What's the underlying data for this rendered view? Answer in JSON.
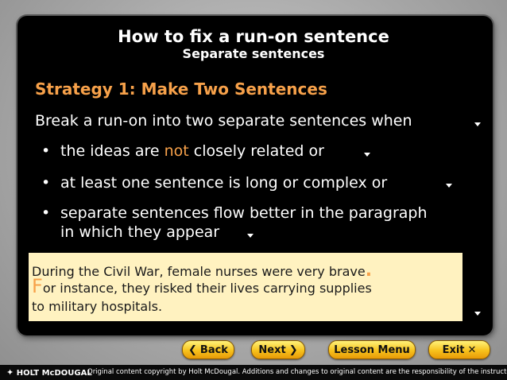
{
  "slide": {
    "title": "How to fix a run-on sentence",
    "subtitle": "Separate sentences",
    "strategy": "Strategy 1: Make Two Sentences",
    "intro": "Break a run-on into two separate sentences when",
    "bullets": [
      {
        "before": "the ideas are ",
        "highlight": "not",
        "after": " closely related or"
      },
      {
        "text": "at least one sentence is long or complex or"
      },
      {
        "line1": "separate sentences flow better in the paragraph",
        "line2": "in which they appear"
      }
    ],
    "example": {
      "line1": "During the Civil War, female nurses were very brave",
      "period": ".",
      "cap": "F",
      "line2_rest": "or instance, they risked their lives carrying supplies",
      "line3": "to military hospitals."
    }
  },
  "nav": {
    "back": "Back",
    "next": "Next",
    "menu": "Lesson Menu",
    "exit": "Exit",
    "back_arrow": "❮",
    "next_arrow": "❯",
    "exit_x": "✕"
  },
  "footer": {
    "brand": "HOLT McDOUGAL",
    "copyright": "Original content copyright by Holt McDougal. Additions and changes to original content are the responsibility of the instructor."
  },
  "colors": {
    "accent": "#f7a14a",
    "example_bg": "#fff2c0",
    "button": "#f7c21c"
  }
}
